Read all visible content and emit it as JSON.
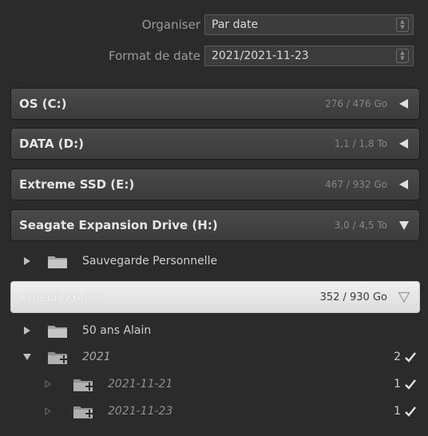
{
  "settings": {
    "organize_label": "Organiser",
    "organize_value": "Par date",
    "date_format_label": "Format de date",
    "date_format_value": "2021/2021-11-23"
  },
  "volumes": [
    {
      "name": "OS (C:)",
      "space": "276 / 476 Go",
      "state": "collapsed"
    },
    {
      "name": "DATA (D:)",
      "space": "1,1 / 1,8 To",
      "state": "collapsed"
    },
    {
      "name": "Extreme SSD (E:)",
      "space": "467 / 932 Go",
      "state": "collapsed"
    },
    {
      "name": "Seagate Expansion Drive (H:)",
      "space": "3,0 / 4,5 To",
      "state": "expanded"
    },
    {
      "name": "Crucial X6 (I:)",
      "space": "352 / 930 Go",
      "state": "expanded-selected"
    }
  ],
  "folders": {
    "seagate": [
      {
        "name": "Sauvegarde Personnelle"
      }
    ],
    "crucial": [
      {
        "name": "50 ans Alain",
        "count": ""
      },
      {
        "name": "2021",
        "count": "2"
      },
      {
        "name": "2021-11-21",
        "count": "1"
      },
      {
        "name": "2021-11-23",
        "count": "1"
      }
    ]
  },
  "colors": {
    "panel_bg": "#2b2b2b",
    "header_bg": "#444444",
    "selected_header_bg": "#e8e8e8",
    "text": "#d4d4d4"
  }
}
